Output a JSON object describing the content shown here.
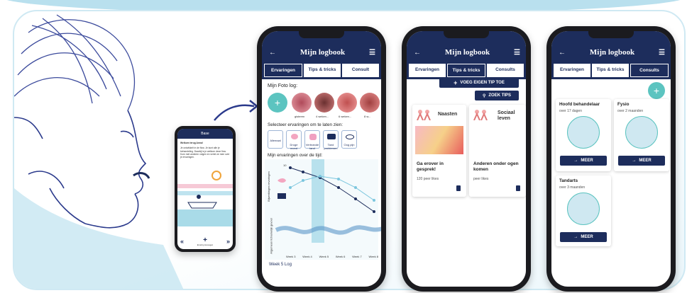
{
  "small_phone": {
    "title": "Base",
    "intro": "Welkom terug Anna!",
    "body": "Je ontwikkelt in de flow. Je kunt alle je behandeling. Daarbij is je welkom deze flow. Kom met anderen volgen en vertel ze mee over je ervaringen.",
    "add_label": "Ervaring toevoegen",
    "next_label": "Volgende",
    "prev_label": "Vorige"
  },
  "phone1": {
    "title": "Mijn logbook",
    "tabs": [
      "Ervaringen",
      "Tips & tricks",
      "Consult"
    ],
    "section_photo": "Mijn Foto log:",
    "photo_captions": [
      "gisteren",
      "4 weken...",
      "6 weken...",
      "8 w..."
    ],
    "section_select": "Selecteer ervaringen om te laten zien:",
    "chips": [
      "Allemaal",
      "Droge mond",
      "Verbrande tand",
      "Tand problemen",
      "Oog pijn"
    ],
    "section_chart": "Mijn ervaringen over de tijd:",
    "ylabel_top": "Bijwerkingen ervaringen",
    "ylabel_bottom": "Algemeen lichamelijk gevoel",
    "weeks": [
      "Week 3",
      "Week 4",
      "Week 5",
      "Week 6",
      "Week 7",
      "Week 8"
    ],
    "y_tick": "10",
    "footer": "Week 5 Log"
  },
  "phone2": {
    "title": "Mijn logbook",
    "tabs": [
      "Ervaringen",
      "Tips & tricks",
      "Consults"
    ],
    "add_tip": "VOEG EIGEN TIP TOE",
    "search_tips": "ZOEK TIPS",
    "card1_title": "Naasten",
    "card2_title": "Sociaal leven",
    "card1_text": "Ga erover in gesprek!",
    "card1_likes": "120 peer likes",
    "card2_text": "Anderen onder ogen komen",
    "card2_likes": "peer likes"
  },
  "phone3": {
    "title": "Mijn logbook",
    "tabs": [
      "Ervaringen",
      "Tips & tricks",
      "Consults"
    ],
    "c1_title": "Hoofd behandelaar",
    "c1_time": "over 17 dagen",
    "c2_title": "Fysio",
    "c2_time": "over 2 maanden",
    "c3_title": "Tandarts",
    "c3_time": "over 3 maanden",
    "more": "MEER"
  },
  "colors": {
    "navy": "#1d2d5c",
    "teal": "#5cc4c0",
    "light_blue": "#a9dbe8"
  }
}
